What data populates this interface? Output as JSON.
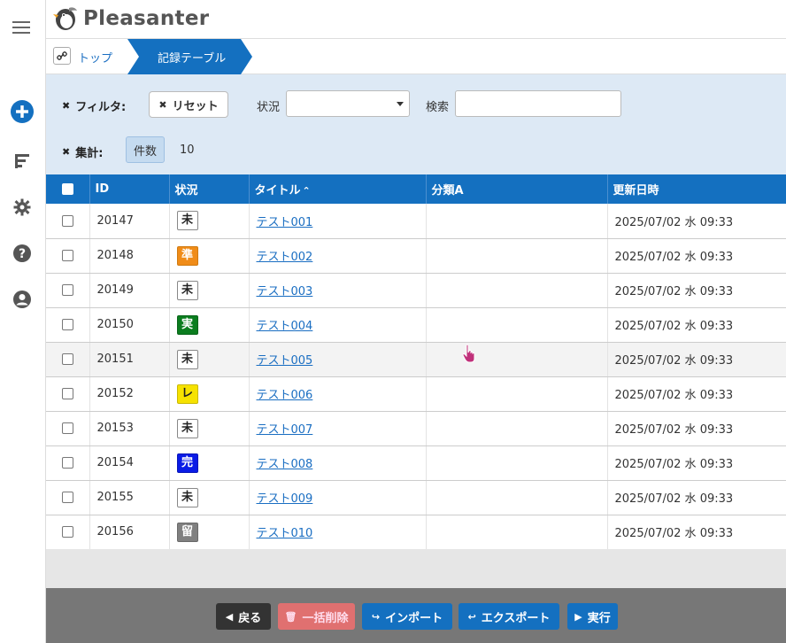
{
  "app": {
    "logo_text": "Pleasanter"
  },
  "breadcrumb": {
    "top_label": "トップ",
    "current_label": "記録テーブル"
  },
  "filters": {
    "filter_label": "フィルタ:",
    "reset_label": "リセット",
    "status_label": "状況",
    "status_value": "",
    "search_label": "検索",
    "search_value": "",
    "aggregate_label": "集計:",
    "count_label": "件数",
    "count_value": "10"
  },
  "table": {
    "headers": {
      "id": "ID",
      "status": "状況",
      "title": "タイトル",
      "title_sort": "⌃",
      "class_a": "分類A",
      "updated": "更新日時"
    },
    "rows": [
      {
        "id": "20147",
        "status": "未",
        "status_color": "white",
        "title": "テスト001",
        "class_a": "",
        "updated": "2025/07/02 水 09:33"
      },
      {
        "id": "20148",
        "status": "準",
        "status_color": "orange",
        "title": "テスト002",
        "class_a": "",
        "updated": "2025/07/02 水 09:33"
      },
      {
        "id": "20149",
        "status": "未",
        "status_color": "white",
        "title": "テスト003",
        "class_a": "",
        "updated": "2025/07/02 水 09:33"
      },
      {
        "id": "20150",
        "status": "実",
        "status_color": "green",
        "title": "テスト004",
        "class_a": "",
        "updated": "2025/07/02 水 09:33"
      },
      {
        "id": "20151",
        "status": "未",
        "status_color": "white",
        "title": "テスト005",
        "class_a": "",
        "updated": "2025/07/02 水 09:33"
      },
      {
        "id": "20152",
        "status": "レ",
        "status_color": "yellow",
        "title": "テスト006",
        "class_a": "",
        "updated": "2025/07/02 水 09:33"
      },
      {
        "id": "20153",
        "status": "未",
        "status_color": "white",
        "title": "テスト007",
        "class_a": "",
        "updated": "2025/07/02 水 09:33"
      },
      {
        "id": "20154",
        "status": "完",
        "status_color": "blue",
        "title": "テスト008",
        "class_a": "",
        "updated": "2025/07/02 水 09:33"
      },
      {
        "id": "20155",
        "status": "未",
        "status_color": "white",
        "title": "テスト009",
        "class_a": "",
        "updated": "2025/07/02 水 09:33"
      },
      {
        "id": "20156",
        "status": "留",
        "status_color": "gray",
        "title": "テスト010",
        "class_a": "",
        "updated": "2025/07/02 水 09:33"
      }
    ]
  },
  "footer": {
    "back_label": "戻る",
    "bulk_delete_label": "一括削除",
    "import_label": "インポート",
    "export_label": "エクスポート",
    "run_label": "実行"
  },
  "colors": {
    "header_blue": "#1470c0",
    "filter_bg": "#dde9f5",
    "link": "#1a6ec2",
    "footer_bg": "#777777",
    "back_btn": "#333333",
    "delete_btn": "#e07070",
    "action_btn": "#1470c0"
  },
  "icons": {
    "rail": [
      "menu-icon",
      "add-icon",
      "sort-icon",
      "gear-icon",
      "help-icon",
      "user-icon"
    ]
  }
}
